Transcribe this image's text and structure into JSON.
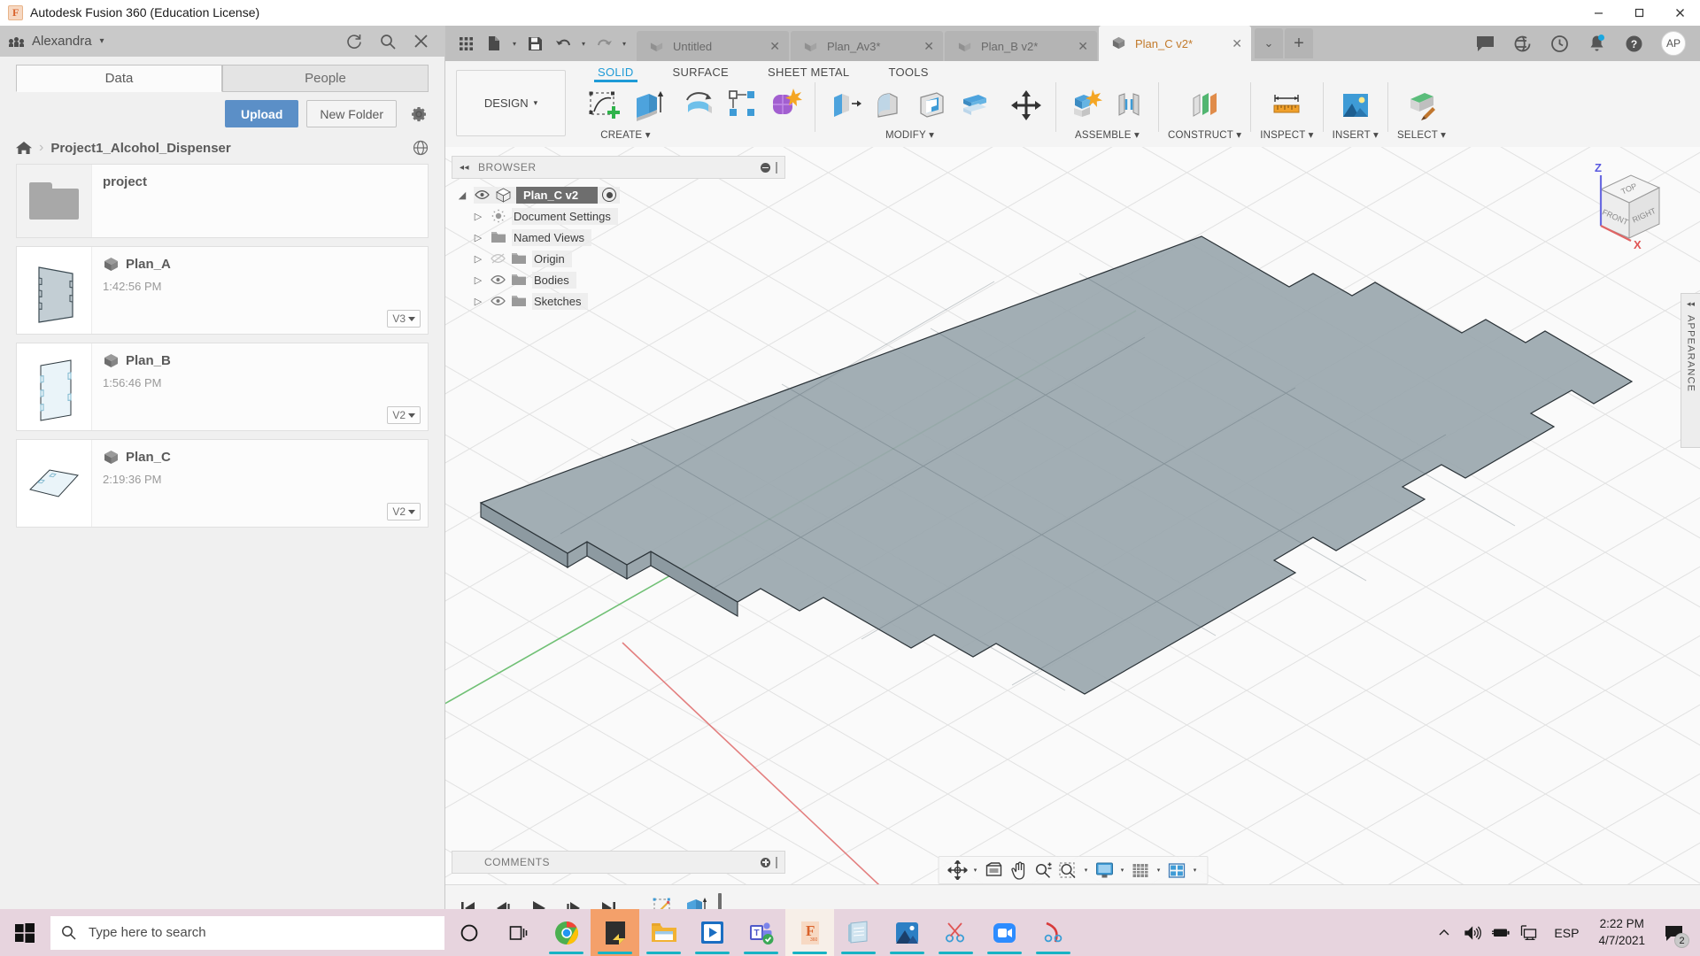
{
  "window": {
    "title": "Autodesk Fusion 360 (Education License)",
    "minimize": "–",
    "maximize": "❐",
    "close": "✕"
  },
  "data_panel": {
    "hub_user": "Alexandra",
    "hub_caret": "▾",
    "header_icons": [
      "refresh-icon",
      "search-icon",
      "close-icon"
    ],
    "tabs": [
      {
        "label": "Data",
        "active": true
      },
      {
        "label": "People",
        "active": false
      }
    ],
    "upload_label": "Upload",
    "new_folder_label": "New Folder",
    "breadcrumb": {
      "home": "home-icon",
      "separator": "›",
      "project": "Project1_Alcohol_Dispenser"
    },
    "items": [
      {
        "type": "folder",
        "name": "project",
        "time": "",
        "version": ""
      },
      {
        "type": "document",
        "name": "Plan_A",
        "time": "1:42:56 PM",
        "version": "V3"
      },
      {
        "type": "document",
        "name": "Plan_B",
        "time": "1:56:46 PM",
        "version": "V2"
      },
      {
        "type": "document",
        "name": "Plan_C",
        "time": "2:19:36 PM",
        "version": "V2"
      }
    ]
  },
  "doc_tabs": {
    "quick_access": [
      "grid-apps-icon",
      "new-file-icon",
      "save-icon",
      "undo-icon",
      "redo-icon"
    ],
    "tabs": [
      {
        "label": "Untitled",
        "active": false,
        "close": "✕"
      },
      {
        "label": "Plan_Av3*",
        "active": false,
        "close": "✕"
      },
      {
        "label": "Plan_B v2*",
        "active": false,
        "close": "✕"
      },
      {
        "label": "Plan_C v2*",
        "active": true,
        "close": "✕"
      }
    ],
    "overflow_caret": "⌄",
    "new_tab": "+",
    "system_icons": [
      "comments-icon",
      "globe-help-icon",
      "recent-clock-icon",
      "notification-bell-icon",
      "help-question-icon"
    ],
    "avatar_initials": "AP"
  },
  "ribbon": {
    "workspace": "DESIGN",
    "workspace_caret": "▾",
    "tabs": [
      {
        "label": "SOLID",
        "active": true
      },
      {
        "label": "SURFACE",
        "active": false
      },
      {
        "label": "SHEET METAL",
        "active": false
      },
      {
        "label": "TOOLS",
        "active": false
      }
    ],
    "groups": [
      {
        "label": "CREATE",
        "caret": "▾",
        "icons": [
          "create-sketch-icon",
          "extrude-icon",
          "revolve-icon",
          "pattern-icon",
          "form-icon"
        ]
      },
      {
        "label": "MODIFY",
        "caret": "▾",
        "icons": [
          "press-pull-icon",
          "fillet-icon",
          "shell-icon",
          "split-face-icon"
        ]
      },
      {
        "label": "",
        "caret": "",
        "icons": [
          "move-copy-icon"
        ]
      },
      {
        "label": "ASSEMBLE",
        "caret": "▾",
        "icons": [
          "new-component-icon",
          "joint-icon"
        ]
      },
      {
        "label": "CONSTRUCT",
        "caret": "▾",
        "icons": [
          "offset-plane-icon"
        ]
      },
      {
        "label": "INSPECT",
        "caret": "▾",
        "icons": [
          "measure-icon"
        ]
      },
      {
        "label": "INSERT",
        "caret": "▾",
        "icons": [
          "insert-image-icon"
        ]
      },
      {
        "label": "SELECT",
        "caret": "▾",
        "icons": [
          "select-paint-icon"
        ]
      }
    ]
  },
  "browser": {
    "title": "BROWSER",
    "collapse_icon": "◂◂",
    "nodes": [
      {
        "label": "Plan_C v2",
        "root": true,
        "eye": true,
        "arrow": "◢",
        "icon": "component-cube-icon",
        "radio": true
      },
      {
        "label": "Document Settings",
        "root": false,
        "eye": false,
        "arrow": "▷",
        "icon": "gear-icon"
      },
      {
        "label": "Named Views",
        "root": false,
        "eye": false,
        "arrow": "▷",
        "icon": "folder-icon"
      },
      {
        "label": "Origin",
        "root": false,
        "eye": true,
        "eye_off": true,
        "arrow": "▷",
        "icon": "folder-icon"
      },
      {
        "label": "Bodies",
        "root": false,
        "eye": true,
        "arrow": "▷",
        "icon": "folder-icon"
      },
      {
        "label": "Sketches",
        "root": false,
        "eye": true,
        "arrow": "▷",
        "icon": "folder-icon"
      }
    ]
  },
  "viewcube": {
    "faces": [
      "TOP",
      "FRONT",
      "RIGHT"
    ],
    "axes": [
      {
        "label": "Z",
        "color": "#5a5ae0"
      },
      {
        "label": "X",
        "color": "#e06060"
      }
    ]
  },
  "appearance_tab": {
    "label": "APPEARANCE",
    "arrow": "◂◂"
  },
  "comments": {
    "label": "COMMENTS"
  },
  "navbar": {
    "icons": [
      "orbit-icon",
      "look-at-icon",
      "pan-icon",
      "zoom-icon",
      "zoom-window-icon",
      "display-settings-icon",
      "grid-snap-icon",
      "viewports-icon"
    ]
  },
  "timeline": {
    "controls": [
      "go-to-beginning-icon",
      "step-back-icon",
      "play-icon",
      "step-forward-icon",
      "go-to-end-icon"
    ],
    "features": [
      "sketch-feature-icon",
      "extrude-feature-icon"
    ],
    "marker": "timeline-marker"
  },
  "taskbar": {
    "start": "windows-start-icon",
    "search_placeholder": "Type here to search",
    "task_icons": [
      "cortana-icon",
      "task-view-icon"
    ],
    "apps": [
      {
        "name": "chrome-icon",
        "active": false
      },
      {
        "name": "sticky-notes-icon",
        "active": true
      },
      {
        "name": "file-explorer-icon",
        "active": false
      },
      {
        "name": "movies-tv-icon",
        "active": false
      },
      {
        "name": "microsoft-teams-icon",
        "active": false
      },
      {
        "name": "fusion360-icon",
        "active": false,
        "light": true
      },
      {
        "name": "notepad-icon",
        "active": false
      },
      {
        "name": "photos-icon",
        "active": false
      },
      {
        "name": "snipping-tool-icon",
        "active": false
      },
      {
        "name": "zoom-meetings-icon",
        "active": false
      },
      {
        "name": "snip-sketch-icon",
        "active": false
      }
    ],
    "tray": {
      "chevron": "⌃",
      "icons": [
        "volume-icon",
        "battery-icon",
        "network-icon"
      ],
      "language": "ESP",
      "time": "2:22 PM",
      "date": "4/7/2021",
      "notification_count": "2"
    }
  }
}
